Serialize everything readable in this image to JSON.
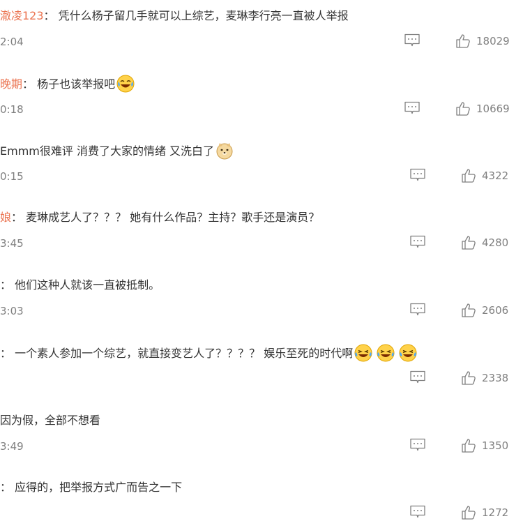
{
  "comments": [
    {
      "user": "澈凌123",
      "text": "凭什么杨子留几手就可以上综艺，麦琳李行亮一直被人举报",
      "time": "2:04",
      "likes": "18029",
      "emoji": []
    },
    {
      "user": "晚期",
      "text": "杨子也该举报吧",
      "time": "0:18",
      "likes": "10669",
      "emoji": [
        "laugh-cry"
      ]
    },
    {
      "user": "",
      "text": "Emmm很难评 消费了大家的情绪 又洗白了",
      "time": "0:15",
      "likes": "4322",
      "emoji": [
        "doge"
      ]
    },
    {
      "user": "娘",
      "text": "麦琳成艺人了？？？ 她有什么作品？主持？歌手还是演员？",
      "time": "3:45",
      "likes": "4280",
      "emoji": []
    },
    {
      "user": "",
      "text": "他们这种人就该一直被抵制。",
      "time": "3:03",
      "likes": "2606",
      "emoji": []
    },
    {
      "user": "",
      "text": "一个素人参加一个综艺，就直接变艺人了？？？？ 娱乐至死的时代啊",
      "time": "",
      "likes": "2338",
      "emoji": [
        "laugh-tears",
        "laugh-tears",
        "laugh-tears"
      ]
    },
    {
      "user": "",
      "text": "因为假，全部不想看",
      "time": "3:49",
      "likes": "1350",
      "emoji": []
    },
    {
      "user": "",
      "text": "应得的，把举报方式广而告之一下",
      "time": "",
      "likes": "1272",
      "emoji": []
    }
  ],
  "colors": {
    "username": "#eb7350",
    "text": "#333333",
    "meta": "#808080"
  },
  "icons": {
    "reply": "comment-icon",
    "like": "thumbs-up-icon"
  }
}
